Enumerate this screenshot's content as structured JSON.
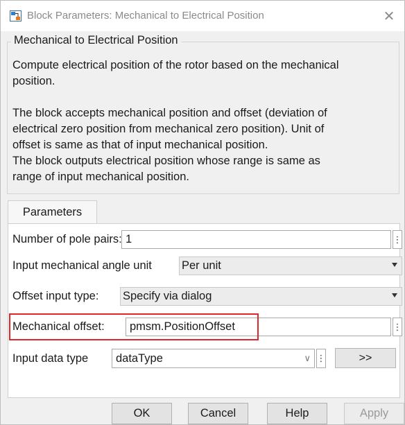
{
  "window": {
    "title": "Block Parameters: Mechanical to Electrical Position",
    "close_glyph": "✕"
  },
  "description": {
    "group_title": "Mechanical to Electrical Position",
    "lines": [
      "Compute electrical position of the rotor based on the mechanical",
      "position.",
      "The block accepts mechanical position  and offset (deviation of",
      "electrical zero position from mechanical zero position). Unit of",
      "offset is same as that of input mechanical position.",
      "The block outputs electrical position whose range  is same as",
      "range of input mechanical position."
    ]
  },
  "tabs": [
    {
      "label": "Parameters",
      "selected": true
    }
  ],
  "parameters": {
    "pole_pairs": {
      "label": "Number of pole pairs:",
      "value": "1"
    },
    "angle_unit": {
      "label": "Input mechanical angle unit",
      "value": "Per unit"
    },
    "offset_type": {
      "label": "Offset input type:",
      "value": "Specify via dialog"
    },
    "mech_offset": {
      "label": "Mechanical offset:",
      "value": "pmsm.PositionOffset"
    },
    "data_type": {
      "label": "Input data type",
      "value": "dataType",
      "assistant_label": ">>"
    },
    "menu_glyph": "⋮",
    "chevron_glyph": "∨"
  },
  "buttons": {
    "ok": "OK",
    "cancel": "Cancel",
    "help": "Help",
    "apply": "Apply"
  },
  "colors": {
    "highlight": "#e0262a",
    "dialog_bg": "#f0f0f0"
  },
  "icons": {
    "app": "simulink-block-icon",
    "close": "close-icon",
    "menu": "kebab-menu-icon",
    "dropdown": "caret-down-icon"
  }
}
